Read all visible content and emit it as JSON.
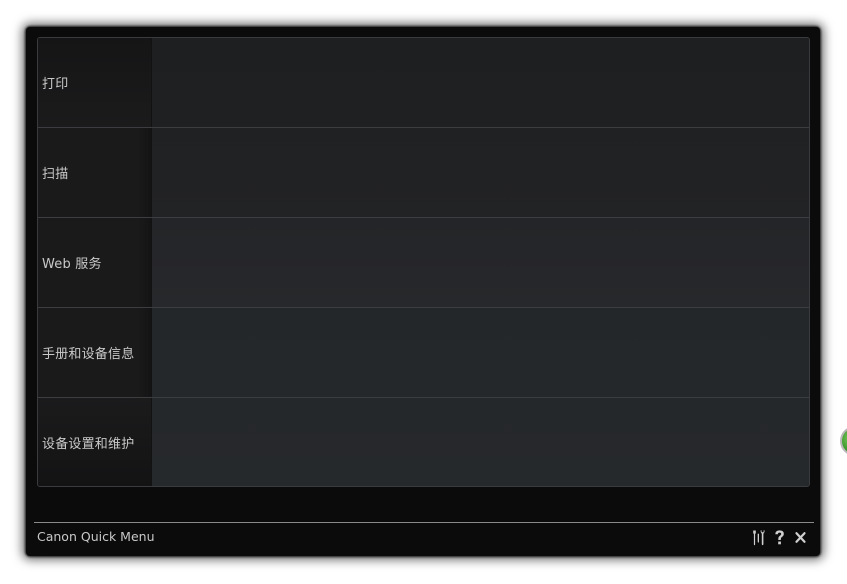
{
  "menu": {
    "items": [
      {
        "label": "打印"
      },
      {
        "label": "扫描"
      },
      {
        "label": "Web 服务"
      },
      {
        "label": "手册和设备信息"
      },
      {
        "label": "设备设置和维护"
      }
    ]
  },
  "footer": {
    "title": "Canon Quick Menu",
    "icons": [
      "preferences-icon",
      "help-icon",
      "close-icon"
    ]
  },
  "colors": {
    "window_bg": "#0b0b0c",
    "panel_label_bg": "#1a1a1b",
    "panel_content_bg": "#25282b",
    "text": "#c9c9c9",
    "side_widget": "#3e9a2d"
  }
}
